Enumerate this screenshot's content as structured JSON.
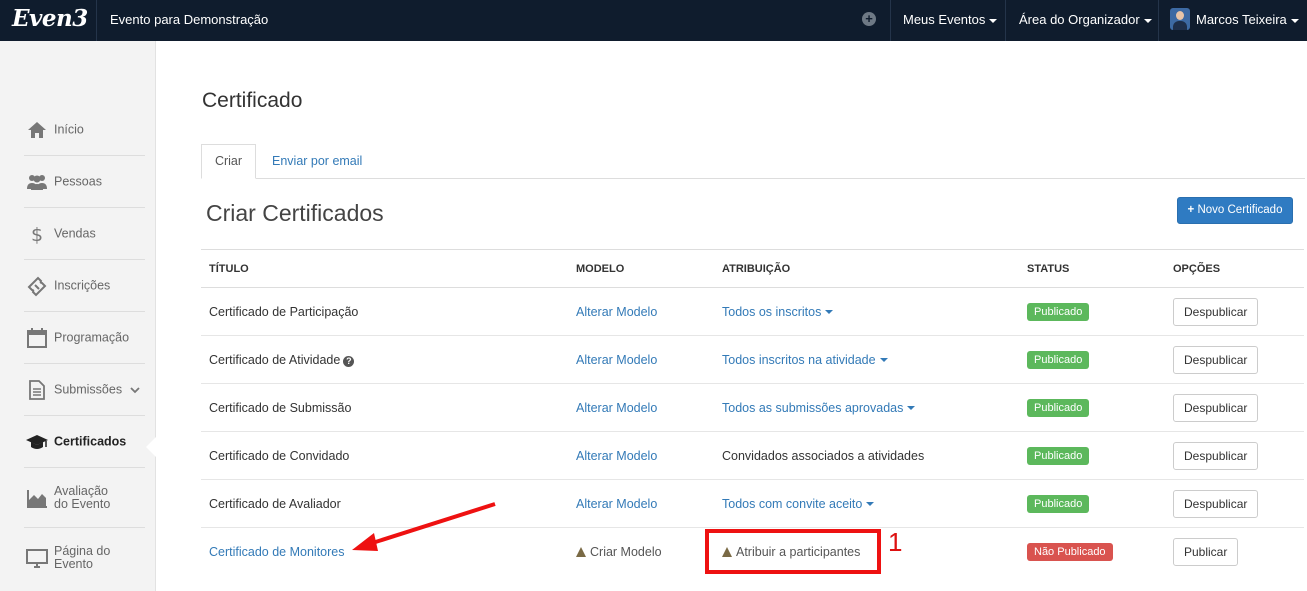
{
  "topbar": {
    "logo_text": "Even3",
    "event_name": "Evento para Demonstração",
    "add_icon": "plus-circle-icon",
    "nav": {
      "meus_eventos": "Meus Eventos",
      "area_organizador": "Área do Organizador",
      "user_name": "Marcos Teixeira"
    }
  },
  "sidebar": {
    "items": [
      {
        "label": "Início",
        "icon": "home-icon"
      },
      {
        "label": "Pessoas",
        "icon": "users-icon"
      },
      {
        "label": "Vendas",
        "icon": "dollar-icon"
      },
      {
        "label": "Inscrições",
        "icon": "ticket-icon"
      },
      {
        "label": "Programação",
        "icon": "calendar-icon"
      },
      {
        "label": "Submissões",
        "icon": "document-icon"
      },
      {
        "label": "Certificados",
        "icon": "graduation-cap-icon"
      },
      {
        "label": "Avaliação do Evento",
        "line1": "Avaliação",
        "line2": "do Evento",
        "icon": "area-chart-icon"
      },
      {
        "label": "Página do Evento",
        "line1": "Página do",
        "line2": "Evento",
        "icon": "monitor-icon"
      }
    ],
    "active": "Certificados"
  },
  "page": {
    "title": "Certificado",
    "tabs": [
      "Criar",
      "Enviar por email"
    ],
    "section_title": "Criar Certificados",
    "new_button": "Novo Certificado"
  },
  "table": {
    "headers": [
      "TÍTULO",
      "MODELO",
      "ATRIBUIÇÃO",
      "STATUS",
      "OPÇÕES"
    ],
    "rows": [
      {
        "title": "Certificado de Participação",
        "model": "Alterar Modelo",
        "assignment": "Todos os inscritos",
        "status": "Publicado",
        "action": "Despublicar"
      },
      {
        "title": "Certificado de Atividade",
        "model": "Alterar Modelo",
        "assignment": "Todos inscritos na atividade",
        "status": "Publicado",
        "action": "Despublicar"
      },
      {
        "title": "Certificado de Submissão",
        "model": "Alterar Modelo",
        "assignment": "Todos as submissões aprovadas",
        "status": "Publicado",
        "action": "Despublicar"
      },
      {
        "title": "Certificado de Convidado",
        "model": "Alterar Modelo",
        "assignment": "Convidados associados a atividades",
        "status": "Publicado",
        "action": "Despublicar"
      },
      {
        "title": "Certificado de Avaliador",
        "model": "Alterar Modelo",
        "assignment": "Todos com convite aceito",
        "status": "Publicado",
        "action": "Despublicar"
      },
      {
        "title": "Certificado de Monitores",
        "model": "Criar Modelo",
        "assignment": "Atribuir a participantes",
        "status": "Não Publicado",
        "action": "Publicar"
      }
    ]
  },
  "annotation": {
    "number": "1"
  },
  "colors": {
    "topbar": "#0f1c2d",
    "primary": "#2f7bc2",
    "link": "#337ab7",
    "published": "#5cb85c",
    "unpublished": "#d9534f",
    "annotation": "#ee1111"
  }
}
